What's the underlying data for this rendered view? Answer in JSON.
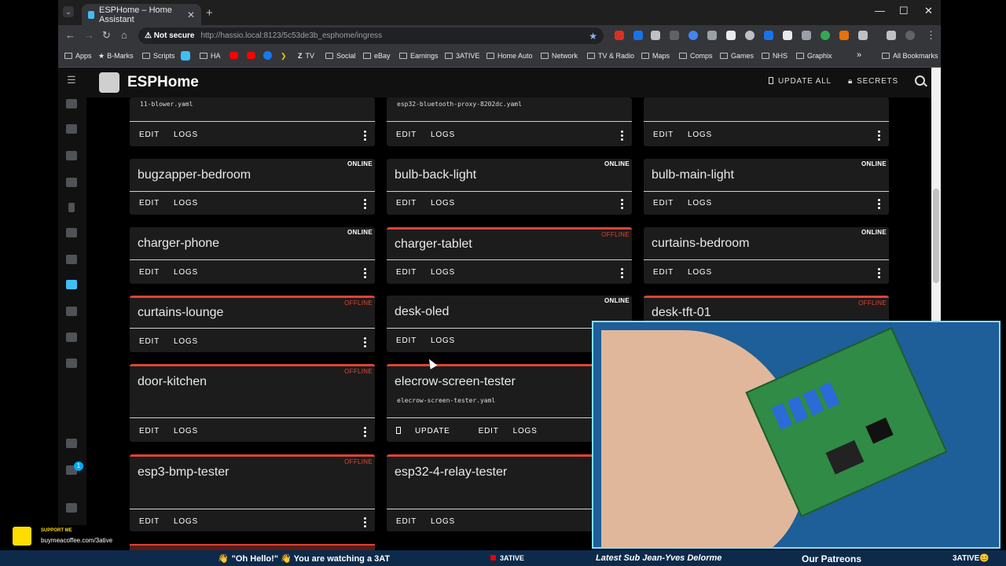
{
  "browser": {
    "tab_title": "ESPHome – Home Assistant",
    "tab_close": "✕",
    "new_tab": "+",
    "window_controls": [
      "—",
      "☐",
      "✕"
    ],
    "nav": [
      "←",
      "→",
      "↻",
      "⌂"
    ],
    "not_secure": "⚠ Not secure",
    "url": "http://hassio.local:8123/5c53de3b_esphome/ingress",
    "bookmarks": [
      "Apps",
      "B-Marks",
      "Scripts",
      "HA",
      "TV",
      "Social",
      "eBay",
      "Earnings",
      "3ATIVE",
      "Home Auto",
      "Network",
      "TV & Radio",
      "Maps",
      "Comps",
      "Games",
      "NHS",
      "Graphix"
    ],
    "all_bookmarks": "All Bookmarks",
    "more": "»"
  },
  "esphome": {
    "brand": "ESPHome",
    "update_all": "UPDATE ALL",
    "secrets": "SECRETS",
    "edit_label": "EDIT",
    "logs_label": "LOGS",
    "update_label": "UPDATE",
    "online_label": "ONLINE",
    "offline_label": "OFFLINE",
    "top_files": [
      "11-blower.yaml",
      "esp32-bluetooth-proxy-8202dc.yaml"
    ],
    "devices": [
      {
        "name": "bugzapper-bedroom",
        "status": "ONLINE"
      },
      {
        "name": "bulb-back-light",
        "status": "ONLINE"
      },
      {
        "name": "bulb-main-light",
        "status": "ONLINE"
      },
      {
        "name": "charger-phone",
        "status": "ONLINE"
      },
      {
        "name": "charger-tablet",
        "status": "OFFLINE"
      },
      {
        "name": "curtains-bedroom",
        "status": "ONLINE"
      },
      {
        "name": "curtains-lounge",
        "status": "OFFLINE"
      },
      {
        "name": "desk-oled",
        "status": "ONLINE"
      },
      {
        "name": "desk-tft-01",
        "status": "OFFLINE"
      },
      {
        "name": "door-kitchen",
        "status": "OFFLINE"
      },
      {
        "name": "elecrow-screen-tester",
        "file": "elecrow-screen-tester.yaml"
      },
      {
        "name": "esp3-bmp-tester",
        "status": "OFFLINE"
      },
      {
        "name": "esp32-4-relay-tester"
      }
    ],
    "notification_count": "1"
  },
  "stream": {
    "support_title": "SUPPORT ME",
    "support_url": "buymeacoffee.com/3ative",
    "ticker": "\"Oh Hello!\" 👋 You are watching a 3AT",
    "channel": "3ATIVE",
    "latest_sub": "Latest Sub Jean-Yves Delorme",
    "patreons": "Our Patreons",
    "brand_right": "3ATIVE😊"
  },
  "colors": {
    "offline": "#db4437",
    "card": "#1c1c1c",
    "accent": "#41bdf5"
  }
}
